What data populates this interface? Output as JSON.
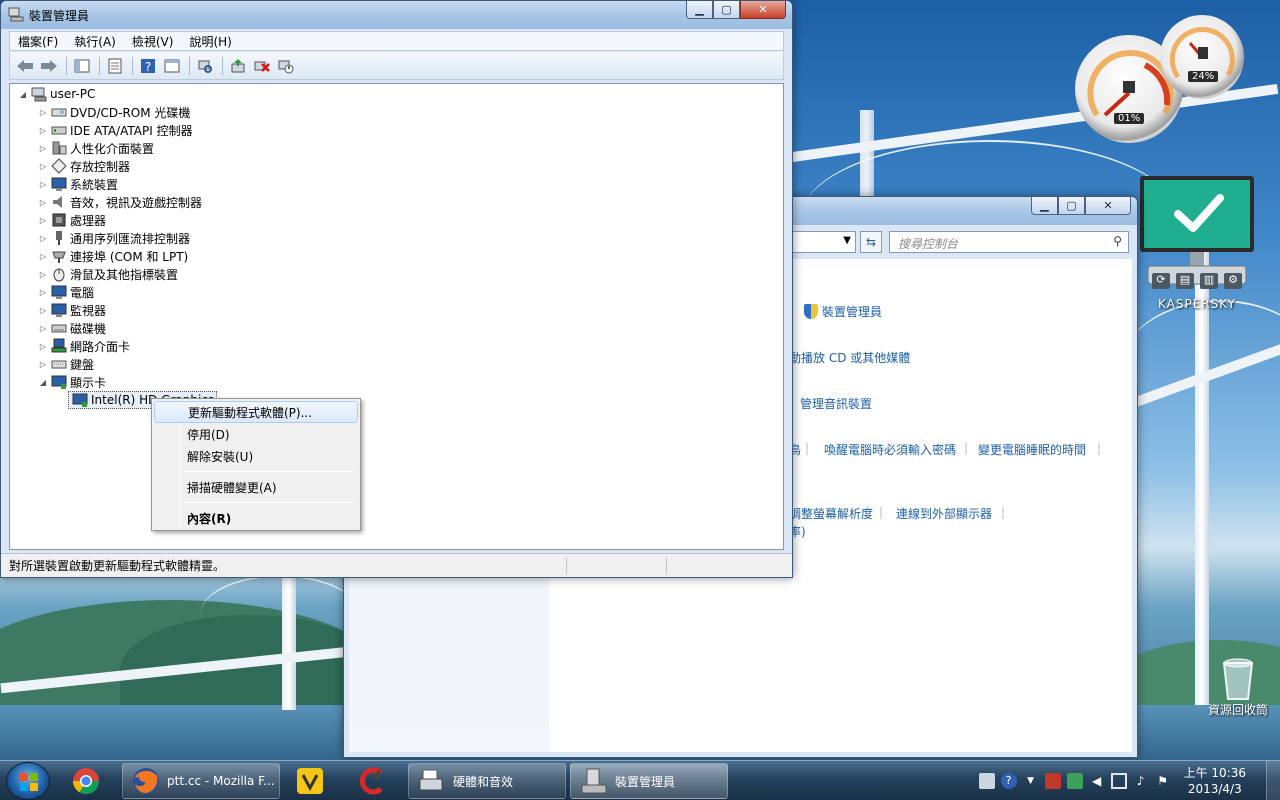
{
  "desktop": {
    "recycle_bin_label": "資源回收筒"
  },
  "device_manager": {
    "title": "裝置管理員",
    "menu": [
      "檔案(F)",
      "執行(A)",
      "檢視(V)",
      "說明(H)"
    ],
    "tree": {
      "root": "user-PC",
      "categories": [
        "DVD/CD-ROM 光碟機",
        "IDE ATA/ATAPI 控制器",
        "人性化介面裝置",
        "存放控制器",
        "系統裝置",
        "音效，視訊及遊戲控制器",
        "處理器",
        "通用序列匯流排控制器",
        "連接埠 (COM 和 LPT)",
        "滑鼠及其他指標裝置",
        "電腦",
        "監視器",
        "磁碟機",
        "網路介面卡",
        "鍵盤",
        "顯示卡"
      ],
      "selected_child": "Intel(R) HD Graphics"
    },
    "context_menu": {
      "update_driver": "更新驅動程式軟體(P)...",
      "disable": "停用(D)",
      "uninstall": "解除安裝(U)",
      "scan": "掃描硬體變更(A)",
      "properties": "內容(R)"
    },
    "status": "對所選裝置啟動更新驅動程式軟體精靈。"
  },
  "control_panel": {
    "search_placeholder": "搜尋控制台",
    "links": {
      "device_manager": "裝置管理員",
      "autoplay": "動播放 CD 或其他媒體",
      "audio": "管理音訊裝置",
      "link_a": "喚醒電腦時必須輸入密碼",
      "link_b": "變更電腦睡眠的時間",
      "link_c": "調整螢幕解析度",
      "link_d": "連線到外部顯示器",
      "link_e": "率)",
      "fragment": "鳥"
    }
  },
  "gadgets": {
    "cpu_percent": "01%",
    "memory_percent": "24%",
    "kaspersky_label": "KASPERSKY"
  },
  "taskbar": {
    "firefox_label": "ptt.cc - Mozilla F...",
    "hardware_sound_label": "硬體和音效",
    "device_manager_label": "裝置管理員",
    "clock_time": "上午 10:36",
    "clock_date": "2013/4/3"
  }
}
